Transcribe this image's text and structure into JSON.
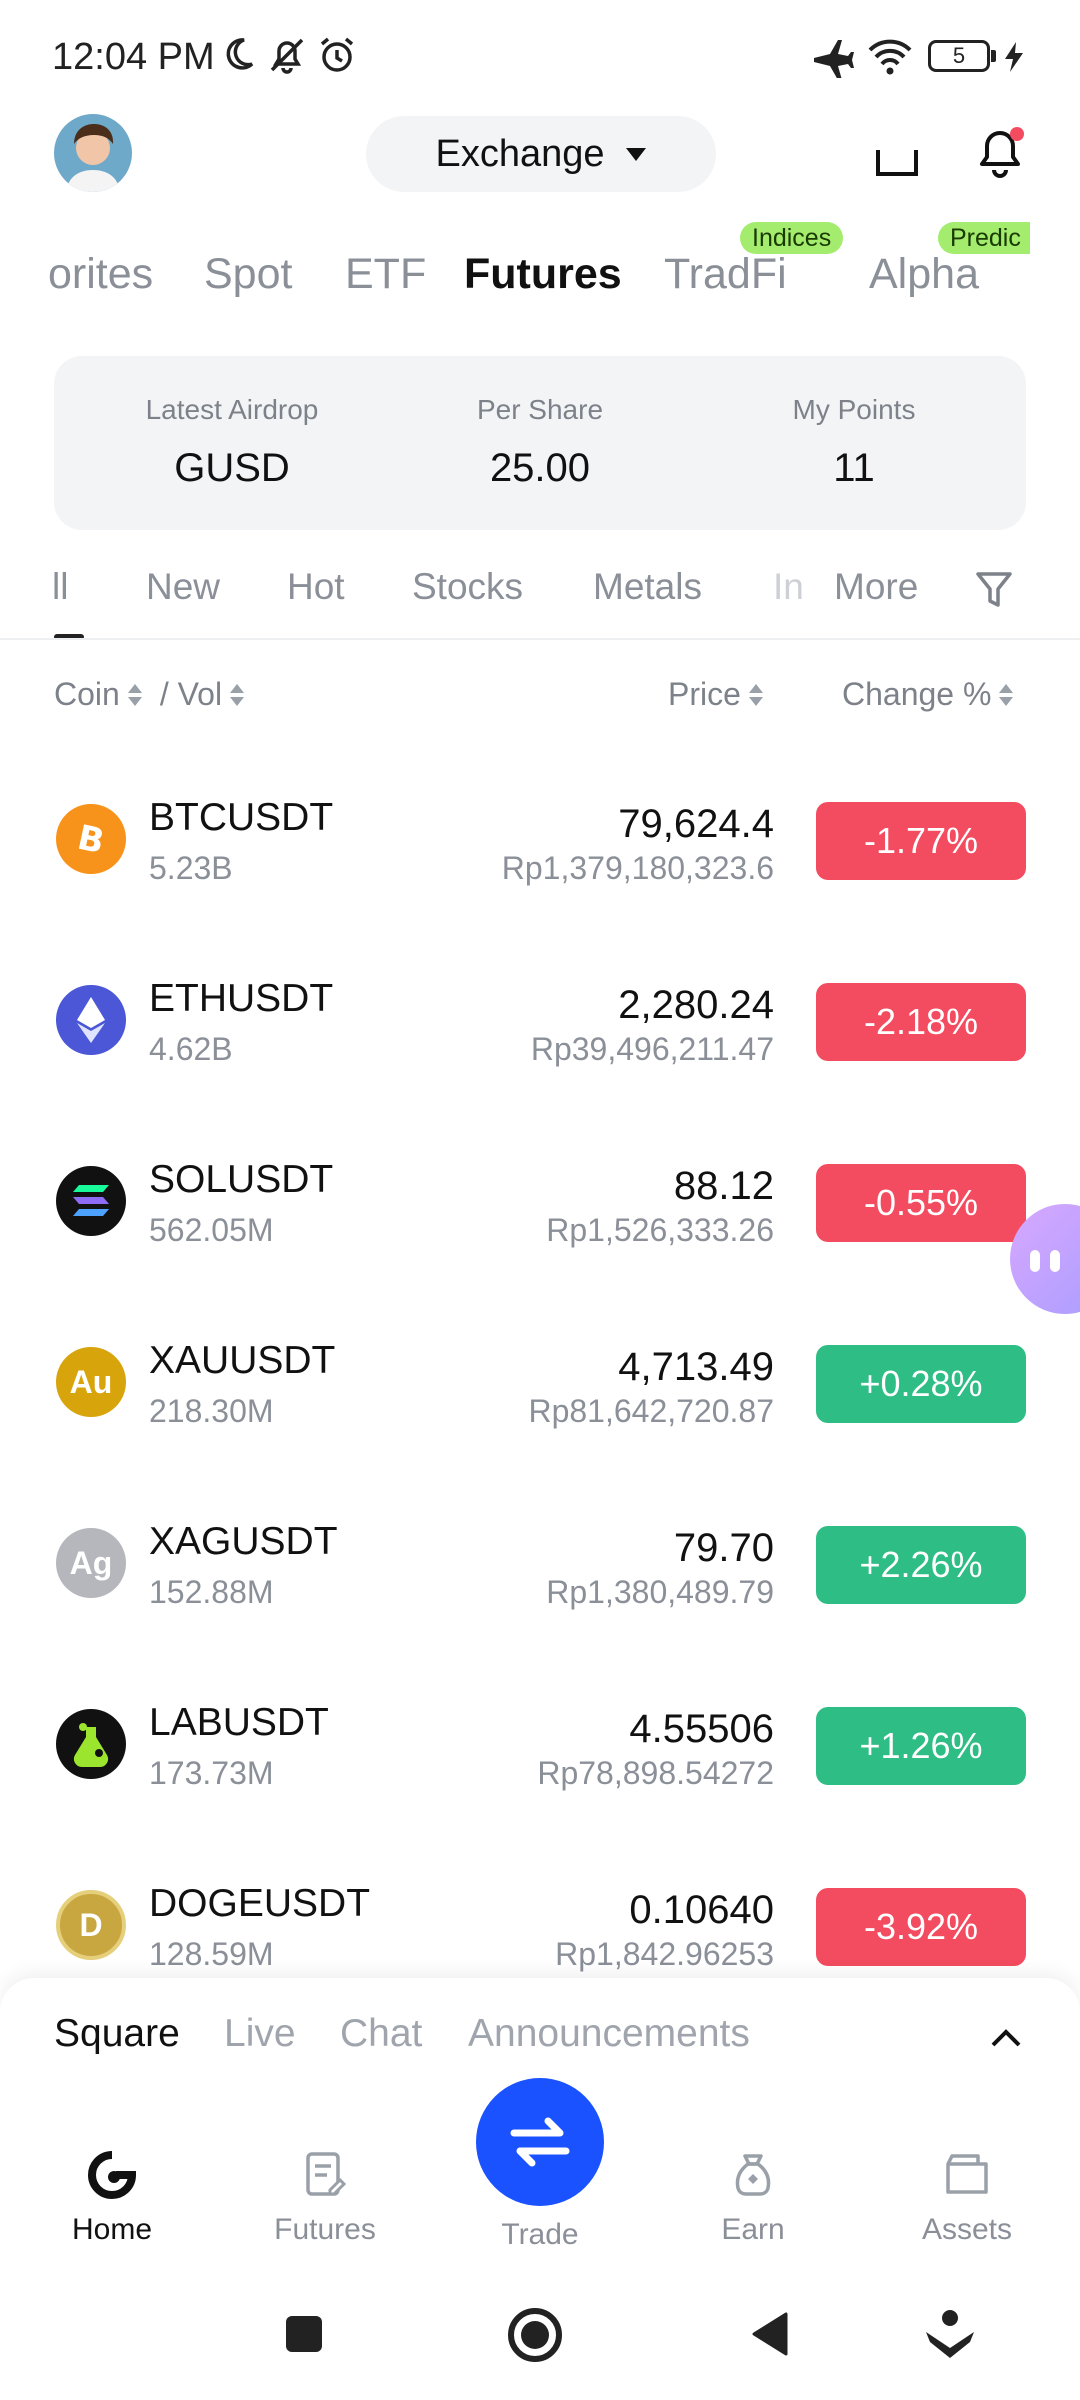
{
  "status_bar": {
    "time": "12:04 PM",
    "battery": "5"
  },
  "header": {
    "exchange_label": "Exchange"
  },
  "category_tabs": [
    {
      "label": "Favorites",
      "visible": "orites",
      "active": false
    },
    {
      "label": "Spot",
      "active": false
    },
    {
      "label": "ETF",
      "active": false
    },
    {
      "label": "Futures",
      "active": true
    },
    {
      "label": "TradFi",
      "active": false,
      "badge": "Indices"
    },
    {
      "label": "Alpha",
      "active": false,
      "badge": "Predic"
    }
  ],
  "airdrop": {
    "latest_label": "Latest Airdrop",
    "latest_value": "GUSD",
    "share_label": "Per Share",
    "share_value": "25.00",
    "points_label": "My Points",
    "points_value": "11"
  },
  "sub_tabs": [
    {
      "label": "All",
      "visible": "ll"
    },
    {
      "label": "New"
    },
    {
      "label": "Hot"
    },
    {
      "label": "Stocks"
    },
    {
      "label": "Metals"
    },
    {
      "label": "In",
      "visible": "In"
    },
    {
      "label": "More"
    }
  ],
  "columns": {
    "coin": "Coin",
    "vol": "/ Vol",
    "price": "Price",
    "change": "Change %"
  },
  "rows": [
    {
      "symbol": "BTCUSDT",
      "vol": "5.23B",
      "price": "79,624.4",
      "idr": "Rp1,379,180,323.6",
      "change": "-1.77%",
      "dir": "down",
      "icon": "bitcoin-icon",
      "icon_color": "#f7931a"
    },
    {
      "symbol": "ETHUSDT",
      "vol": "4.62B",
      "price": "2,280.24",
      "idr": "Rp39,496,211.47",
      "change": "-2.18%",
      "dir": "down",
      "icon": "ethereum-icon",
      "icon_color": "#4b57d6"
    },
    {
      "symbol": "SOLUSDT",
      "vol": "562.05M",
      "price": "88.12",
      "idr": "Rp1,526,333.26",
      "change": "-0.55%",
      "dir": "down",
      "icon": "solana-icon",
      "icon_color": "#111111"
    },
    {
      "symbol": "XAUUSDT",
      "vol": "218.30M",
      "price": "4,713.49",
      "idr": "Rp81,642,720.87",
      "change": "+0.28%",
      "dir": "up",
      "icon": "gold-icon",
      "icon_color": "#d8a40c",
      "icon_text": "Au"
    },
    {
      "symbol": "XAGUSDT",
      "vol": "152.88M",
      "price": "79.70",
      "idr": "Rp1,380,489.79",
      "change": "+2.26%",
      "dir": "up",
      "icon": "silver-icon",
      "icon_color": "#b5b7bd",
      "icon_text": "Ag"
    },
    {
      "symbol": "LABUSDT",
      "vol": "173.73M",
      "price": "4.55506",
      "idr": "Rp78,898.54272",
      "change": "+1.26%",
      "dir": "up",
      "icon": "flask-icon",
      "icon_color": "#111111"
    },
    {
      "symbol": "DOGEUSDT",
      "vol": "128.59M",
      "price": "0.10640",
      "idr": "Rp1,842.96253",
      "change": "-3.92%",
      "dir": "down",
      "icon": "doge-icon",
      "icon_color": "#c8a640",
      "icon_text": "D"
    }
  ],
  "square_tabs": [
    {
      "label": "Square",
      "active": true
    },
    {
      "label": "Live"
    },
    {
      "label": "Chat"
    },
    {
      "label": "Announcements"
    }
  ],
  "nav": {
    "home": "Home",
    "futures": "Futures",
    "trade": "Trade",
    "earn": "Earn",
    "assets": "Assets"
  },
  "colors": {
    "accent": "#1a52ff",
    "down": "#f34b5f",
    "up": "#2ebd85",
    "badge": "#a3ec6e"
  }
}
